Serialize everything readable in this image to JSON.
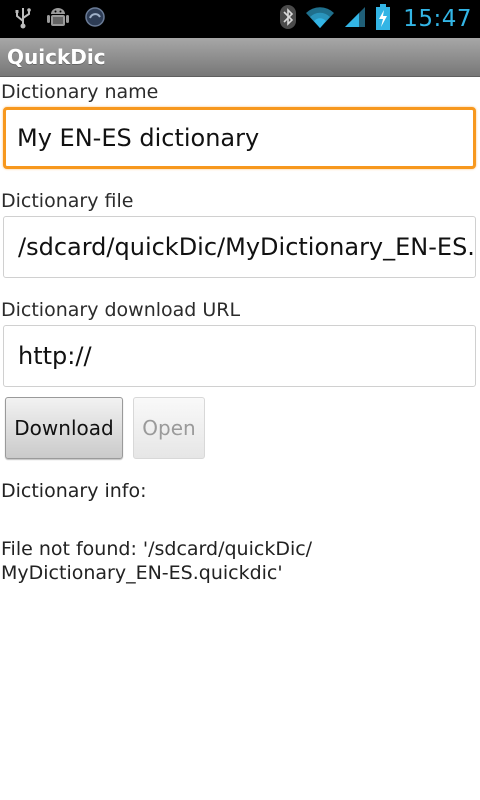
{
  "status_bar": {
    "time": "15:47",
    "icons": [
      "usb-icon",
      "android-debug-icon",
      "app-notification-icon",
      "bluetooth-icon",
      "wifi-icon",
      "signal-icon",
      "battery-charging-icon"
    ]
  },
  "action_bar": {
    "title": "QuickDic"
  },
  "form": {
    "name_label": "Dictionary name",
    "name_value": "My EN-ES dictionary",
    "file_label": "Dictionary file",
    "file_value": "/sdcard/quickDic/MyDictionary_EN-ES.quickdic",
    "url_label": "Dictionary download URL",
    "url_value": "http://"
  },
  "buttons": {
    "download": "Download",
    "open": "Open"
  },
  "info": {
    "label": "Dictionary info:",
    "line1": "File not found: '/sdcard/quickDic/",
    "line2": "MyDictionary_EN-ES.quickdic'"
  },
  "colors": {
    "accent": "#33b5e5",
    "focus": "#f7981e"
  }
}
